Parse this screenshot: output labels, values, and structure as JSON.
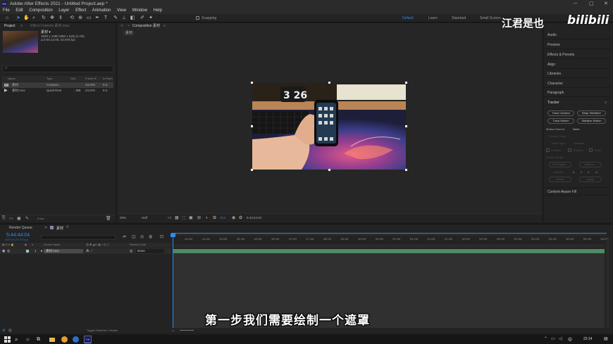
{
  "window": {
    "title": "Adobe After Effects 2021 - Untitled Project.aep *",
    "logo": "Ae"
  },
  "menu": [
    "File",
    "Edit",
    "Composition",
    "Layer",
    "Effect",
    "Animation",
    "View",
    "Window",
    "Help"
  ],
  "toolbar": {
    "snapping": "Snapping",
    "workspaces": [
      "Default",
      "Learn",
      "Standard",
      "Small Screen"
    ],
    "active_workspace": "Default"
  },
  "project": {
    "tab": "Project",
    "effect_tab": "Effect Controls 素材.mov",
    "item_name": "素材 ▾",
    "item_info_1": "1920 x 1080 (960 x 540) (1.00)",
    "item_info_2": "Δ 0:00:12:08, 23.976 fps",
    "search_placeholder": "",
    "columns": [
      "Name",
      "Type",
      "Size",
      "Frame R...",
      "In Point"
    ],
    "rows": [
      {
        "name": "素材",
        "type": "Compos...",
        "size": "",
        "fps": "23.976",
        "in": "5:4"
      },
      {
        "name": "素材.mov",
        "type": "QuickTime",
        "size": "...MB",
        "fps": "23.976",
        "in": "5:4"
      }
    ],
    "footer_bpc": "8 bpc"
  },
  "composition": {
    "tab": "Composition 素材",
    "subtab": "素材",
    "zoom": "25%",
    "resolution": "Half",
    "exposure": "+0.0",
    "timecode": "5:44:44:04"
  },
  "right_panels": [
    "Audio",
    "Preview",
    "Effects & Presets",
    "Align",
    "Libraries",
    "Character",
    "Paragraph"
  ],
  "tracker": {
    "title": "Tracker",
    "buttons": [
      "Track Camera",
      "Warp Stabilizer",
      "Track Motion",
      "Stabilize Motion"
    ],
    "motion_source_label": "Motion Source:",
    "motion_source_value": "None",
    "current_track_label": "Current Track:",
    "track_type_label": "Track Type:",
    "track_type_value": "Stabilize",
    "checks": [
      "Position",
      "Rotation",
      "Scale"
    ],
    "motion_target_label": "Motion Target:",
    "edit_target": "Edit Target...",
    "options": "Options...",
    "analyze_label": "Analyze:",
    "reset": "Reset",
    "apply": "Apply",
    "content_aware": "Content-Aware Fill"
  },
  "timeline": {
    "render_queue": "Render Queue",
    "comp_tab": "素材",
    "timecode": "5:44:44:04",
    "timecode_sub": "0497104 (23.976 fps)",
    "col_source": "Source Name",
    "col_parent": "Parent & Link",
    "layer_num": "1",
    "layer_name": "素材.mov",
    "parent_value": "None",
    "ticks": [
      "44:04f",
      "44:16f",
      "45:04f",
      "45:16f",
      "46:04f",
      "46:16f",
      "47:04f",
      "47:16f",
      "48:04f",
      "48:16f",
      "49:04f",
      "49:16f",
      "50:04f",
      "50:16f",
      "51:04f",
      "51:16f",
      "52:04f",
      "52:16f",
      "53:04f",
      "53:16f",
      "54:04f",
      "54:16f",
      "55:04f",
      "55:16f",
      "56:04f"
    ],
    "footer": "Toggle Switches / Modes"
  },
  "subtitle": "第一步我们需要绘制一个遮罩",
  "watermark": {
    "name": "江君是也",
    "logo": "bilibili"
  },
  "taskbar": {
    "time": "22:14",
    "lang": "中"
  },
  "colors": {
    "accent": "#2d8ceb",
    "track": "#4e8a65",
    "panel": "#232323"
  }
}
